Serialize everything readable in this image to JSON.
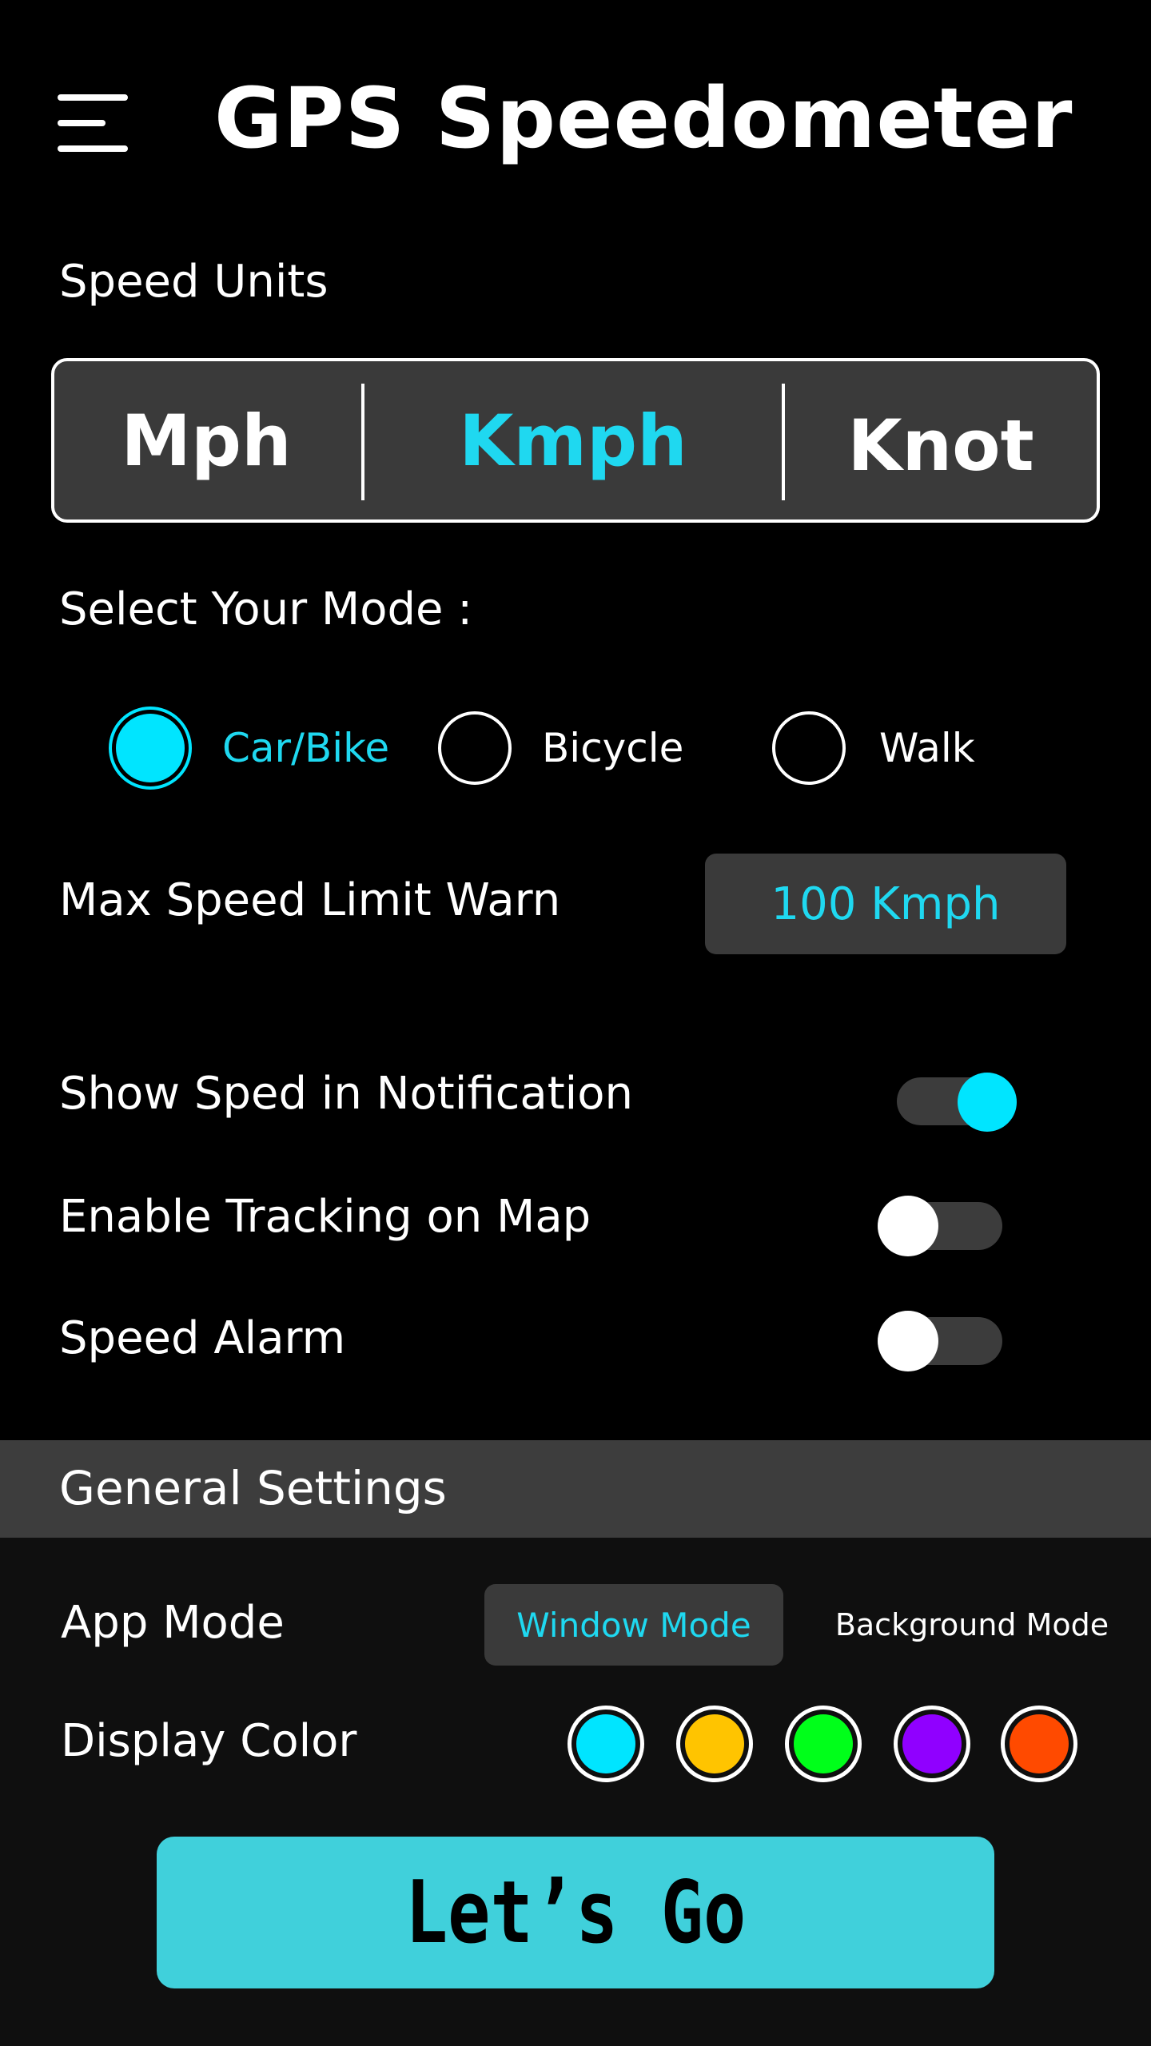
{
  "header": {
    "title": "GPS Speedometer",
    "menu_icon": "hamburger-menu-icon"
  },
  "speed_units": {
    "label": "Speed Units",
    "options": [
      "Mph",
      "Kmph",
      "Knot"
    ],
    "selected": "Kmph"
  },
  "mode": {
    "label": "Select Your Mode :",
    "options": [
      "Car/Bike",
      "Bicycle",
      "Walk"
    ],
    "selected": "Car/Bike"
  },
  "max_speed": {
    "label": "Max Speed Limit Warn",
    "value": "100 Kmph"
  },
  "toggles": [
    {
      "label": "Show Sped in Notification",
      "on": true
    },
    {
      "label": "Enable Tracking on Map",
      "on": false
    },
    {
      "label": "Speed Alarm",
      "on": false
    }
  ],
  "general_settings": {
    "title": "General Settings",
    "app_mode": {
      "label": "App Mode",
      "options": [
        "Window Mode",
        "Background Mode"
      ],
      "selected": "Window Mode"
    },
    "display_color": {
      "label": "Display Color",
      "colors": [
        "#00e5ff",
        "#ffc400",
        "#00ff1a",
        "#9000ff",
        "#ff4a00"
      ]
    }
  },
  "cta": {
    "label": "Let’s Go"
  },
  "colors": {
    "accent": "#00e5ff",
    "cta_bg": "#40d0db",
    "panel": "#3a3a3a"
  }
}
